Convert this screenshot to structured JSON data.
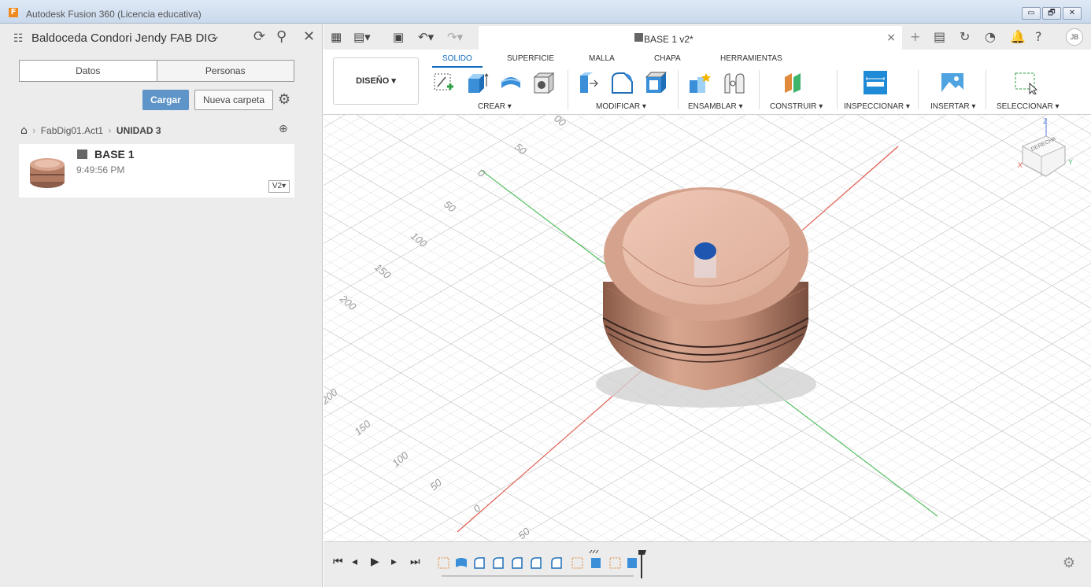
{
  "window": {
    "title": "Autodesk Fusion 360 (Licencia educativa)",
    "app_icon": "F",
    "controls": [
      "▭",
      "🗗",
      "✕"
    ]
  },
  "data_panel": {
    "team_name": "Baldoceda Condori Jendy FAB DIG",
    "tabs": [
      {
        "label": "Datos",
        "active": true
      },
      {
        "label": "Personas",
        "active": false
      }
    ],
    "upload_label": "Cargar",
    "new_folder_label": "Nueva carpeta",
    "breadcrumb": {
      "items": [
        "FabDig01.Act1"
      ],
      "current": "UNIDAD 3"
    },
    "files": [
      {
        "name": "BASE 1",
        "time": "9:49:56 PM",
        "version": "V2▾"
      }
    ]
  },
  "document_tab": {
    "title": "BASE 1 v2*"
  },
  "user": {
    "initials": "JB"
  },
  "ribbon": {
    "workspace": "DISEÑO ▾",
    "tabs": [
      {
        "label": "SOLIDO",
        "active": true
      },
      {
        "label": "SUPERFICIE",
        "active": false
      },
      {
        "label": "MALLA",
        "active": false
      },
      {
        "label": "CHAPA",
        "active": false
      },
      {
        "label": "HERRAMIENTAS",
        "active": false
      }
    ],
    "groups": [
      "CREAR ▾",
      "MODIFICAR ▾",
      "ENSAMBLAR ▾",
      "CONSTRUIR ▾",
      "INSPECCIONAR ▾",
      "INSERTAR ▾",
      "SELECCIONAR ▾"
    ]
  },
  "viewport": {
    "grid_labels_left": [
      "50",
      "0",
      "50",
      "100",
      "150",
      "200"
    ],
    "grid_labels_right": [
      "200",
      "150",
      "100",
      "50",
      "0",
      "50"
    ],
    "grid_label_top": "00",
    "viewcube_face": "DERECHA",
    "viewcube_axes": [
      "Z",
      "X",
      "Y"
    ],
    "colors": {
      "part_top": "#e6b8a3",
      "part_side": "#c98f78",
      "hole": "#1f56b0",
      "axis_red": "#e05a4f",
      "axis_green": "#55c062"
    }
  },
  "timeline": {
    "controls": [
      "⏮",
      "◂",
      "▶",
      "▸",
      "⏭"
    ]
  }
}
